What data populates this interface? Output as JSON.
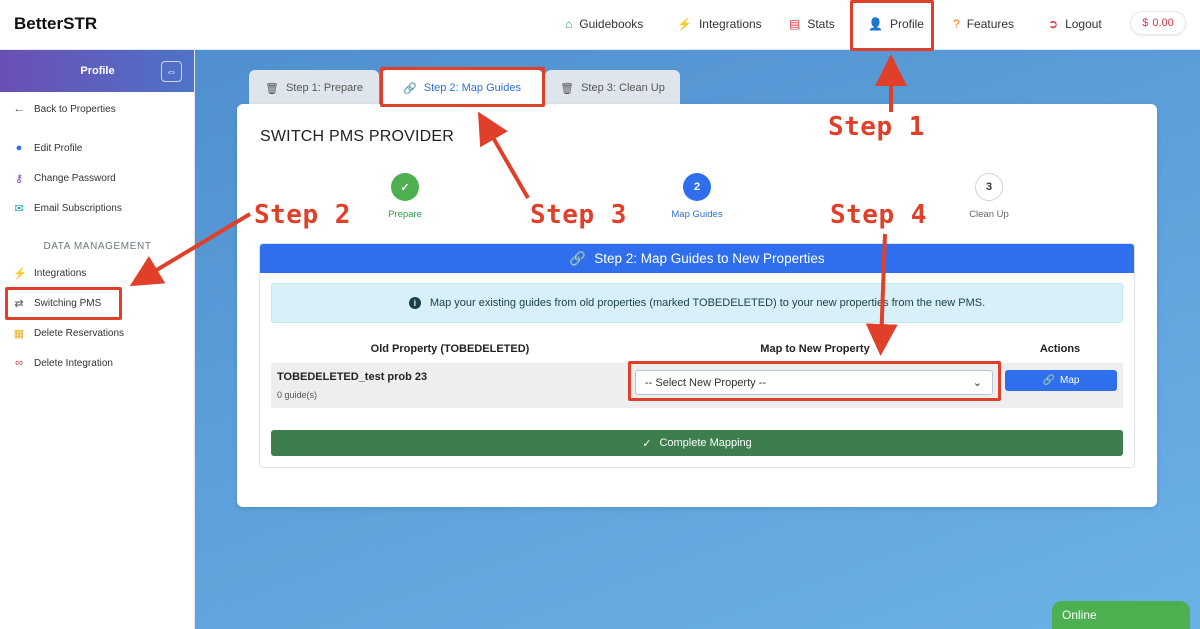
{
  "brand": "BetterSTR",
  "nav": {
    "guidebooks": "Guidebooks",
    "integrations": "Integrations",
    "stats": "Stats",
    "profile": "Profile",
    "features": "Features",
    "logout": "Logout",
    "balance": "0.00",
    "balance_symbol": "$"
  },
  "sidebar": {
    "title": "Profile",
    "back": "Back to Properties",
    "items": [
      "Edit Profile",
      "Change Password",
      "Email Subscriptions"
    ],
    "section_label": "DATA MANAGEMENT",
    "data_items": [
      "Integrations",
      "Switching PMS",
      "Delete Reservations",
      "Delete Integration"
    ]
  },
  "tabs": [
    "Step 1: Prepare",
    "Step 2: Map Guides",
    "Step 3: Clean Up"
  ],
  "card": {
    "title": "SWITCH PMS PROVIDER",
    "steps": [
      {
        "number": "✓",
        "label": "Prepare"
      },
      {
        "number": "2",
        "label": "Map Guides"
      },
      {
        "number": "3",
        "label": "Clean Up"
      }
    ],
    "panel_title": "Step 2: Map Guides to New Properties",
    "info_text": "Map your existing guides from old properties (marked TOBEDELETED) to your new properties from the new PMS.",
    "columns": [
      "Old Property (TOBEDELETED)",
      "Map to New Property",
      "Actions"
    ],
    "row": {
      "old_property": "TOBEDELETED_test prob 23",
      "guide_count": "0 guide(s)",
      "select_value": "-- Select New Property --",
      "map_button": "Map"
    },
    "complete_button": "Complete Mapping"
  },
  "chat": {
    "status": "Online"
  },
  "annotations": {
    "step1": "Step 1",
    "step2": "Step 2",
    "step3": "Step 3",
    "step4": "Step 4"
  },
  "colors": {
    "primary": "#2f6fed",
    "success": "#3e7e4e",
    "annotation": "#e0402a",
    "step_done": "#4caf50"
  }
}
